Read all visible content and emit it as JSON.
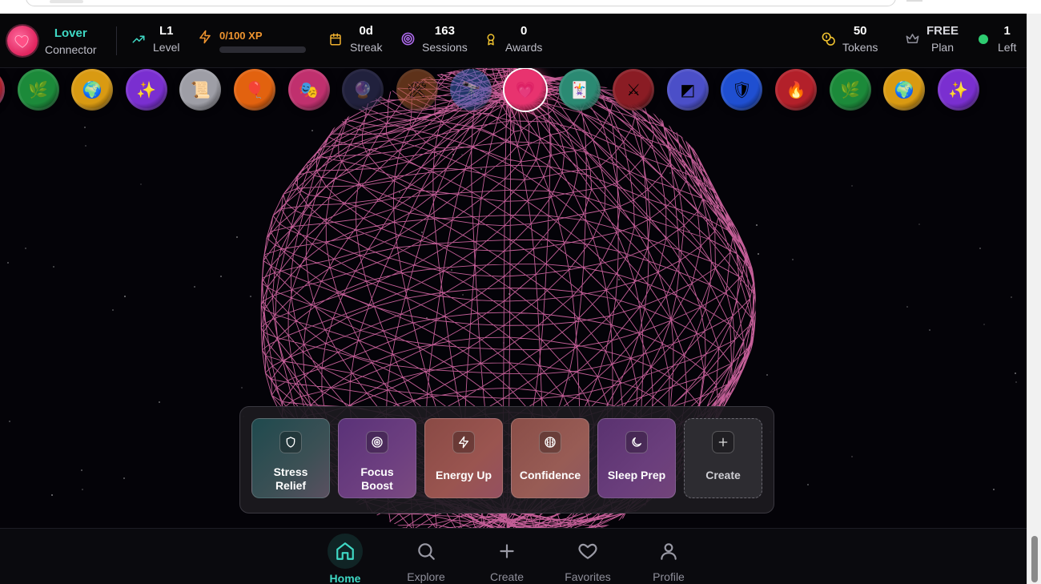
{
  "header": {
    "identity": {
      "name": "Lover",
      "title": "Connector",
      "avatar_icon": "heart-avatar-icon"
    },
    "level": {
      "value": "L1",
      "label": "Level"
    },
    "xp": {
      "value": "0/100 XP",
      "progress": 0
    },
    "streak": {
      "value": "0d",
      "label": "Streak"
    },
    "sessions": {
      "value": "163",
      "label": "Sessions"
    },
    "awards": {
      "value": "0",
      "label": "Awards"
    },
    "tokens": {
      "value": "50",
      "label": "Tokens"
    },
    "plan": {
      "value": "FREE",
      "label": "Plan"
    },
    "left": {
      "value": "1",
      "label": "Left"
    }
  },
  "carousel": [
    {
      "icon": "fire-icon",
      "glyph": "🔥",
      "color": "#b3202a"
    },
    {
      "icon": "leaf-icon",
      "glyph": "🌿",
      "color": "#1c8a3a"
    },
    {
      "icon": "globe-icon",
      "glyph": "🌍",
      "color": "#d99a12"
    },
    {
      "icon": "sparkles-icon",
      "glyph": "✨",
      "color": "#7a2fd0"
    },
    {
      "icon": "scroll-icon",
      "glyph": "📜",
      "color": "#9e9ea6"
    },
    {
      "icon": "balloon-icon",
      "glyph": "🎈",
      "color": "#e2620f"
    },
    {
      "icon": "theater-masks-icon",
      "glyph": "🎭",
      "color": "#c0306e"
    },
    {
      "icon": "crystal-ball-icon",
      "glyph": "🔮",
      "color": "#3a3a6a"
    },
    {
      "icon": "tools-icon",
      "glyph": "🛠",
      "color": "#a85a2a"
    },
    {
      "icon": "telescope-icon",
      "glyph": "🔭",
      "color": "#3a63b8"
    },
    {
      "icon": "heart-icon",
      "glyph": "💗",
      "color": "#e8336f"
    },
    {
      "icon": "joker-card-icon",
      "glyph": "🃏",
      "color": "#2b8a73"
    },
    {
      "icon": "swords-icon",
      "glyph": "⚔",
      "color": "#8a1c24"
    },
    {
      "icon": "portal-icon",
      "glyph": "◩",
      "color": "#4b4fc8"
    },
    {
      "icon": "shield-icon",
      "glyph": "🛡",
      "color": "#1f4fd1"
    },
    {
      "icon": "fire-icon",
      "glyph": "🔥",
      "color": "#b3202a"
    },
    {
      "icon": "leaf-icon",
      "glyph": "🌿",
      "color": "#1c8a3a"
    },
    {
      "icon": "globe-icon",
      "glyph": "🌍",
      "color": "#d99a12"
    },
    {
      "icon": "sparkles-icon",
      "glyph": "✨",
      "color": "#7a2fd0"
    }
  ],
  "modes": [
    {
      "label": "Stress Relief",
      "icon": "shield-icon"
    },
    {
      "label": "Focus Boost",
      "icon": "target-icon"
    },
    {
      "label": "Energy Up",
      "icon": "lightning-icon"
    },
    {
      "label": "Confidence",
      "icon": "brain-icon"
    },
    {
      "label": "Sleep Prep",
      "icon": "moon-icon"
    },
    {
      "label": "Create",
      "icon": "plus-icon"
    }
  ],
  "nav": [
    {
      "label": "Home",
      "icon": "home-icon",
      "active": true
    },
    {
      "label": "Explore",
      "icon": "search-icon",
      "active": false
    },
    {
      "label": "Create",
      "icon": "plus-icon",
      "active": false
    },
    {
      "label": "Favorites",
      "icon": "heart-outline-icon",
      "active": false
    },
    {
      "label": "Profile",
      "icon": "user-icon",
      "active": false
    }
  ],
  "colors": {
    "accent": "#3fd9c5",
    "xp": "#f0952f",
    "wireframe": "#e56fb0",
    "online": "#2ecc71"
  }
}
